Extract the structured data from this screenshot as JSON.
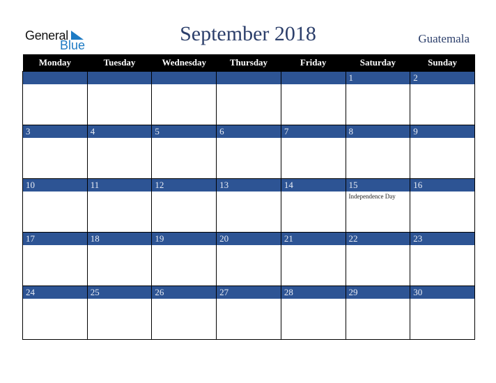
{
  "logo": {
    "line1": "General",
    "line2": "Blue"
  },
  "title": "September 2018",
  "country": "Guatemala",
  "weekdays": [
    "Monday",
    "Tuesday",
    "Wednesday",
    "Thursday",
    "Friday",
    "Saturday",
    "Sunday"
  ],
  "weeks": [
    [
      {
        "day": ""
      },
      {
        "day": ""
      },
      {
        "day": ""
      },
      {
        "day": ""
      },
      {
        "day": ""
      },
      {
        "day": "1"
      },
      {
        "day": "2"
      }
    ],
    [
      {
        "day": "3"
      },
      {
        "day": "4"
      },
      {
        "day": "5"
      },
      {
        "day": "6"
      },
      {
        "day": "7"
      },
      {
        "day": "8"
      },
      {
        "day": "9"
      }
    ],
    [
      {
        "day": "10"
      },
      {
        "day": "11"
      },
      {
        "day": "12"
      },
      {
        "day": "13"
      },
      {
        "day": "14"
      },
      {
        "day": "15",
        "holiday": "Independence Day"
      },
      {
        "day": "16"
      }
    ],
    [
      {
        "day": "17"
      },
      {
        "day": "18"
      },
      {
        "day": "19"
      },
      {
        "day": "20"
      },
      {
        "day": "21"
      },
      {
        "day": "22"
      },
      {
        "day": "23"
      }
    ],
    [
      {
        "day": "24"
      },
      {
        "day": "25"
      },
      {
        "day": "26"
      },
      {
        "day": "27"
      },
      {
        "day": "28"
      },
      {
        "day": "29"
      },
      {
        "day": "30"
      }
    ]
  ],
  "colors": {
    "band": "#2d5494",
    "header": "#000000",
    "title": "#2c3f6b",
    "logo_blue": "#1e7bc4"
  }
}
